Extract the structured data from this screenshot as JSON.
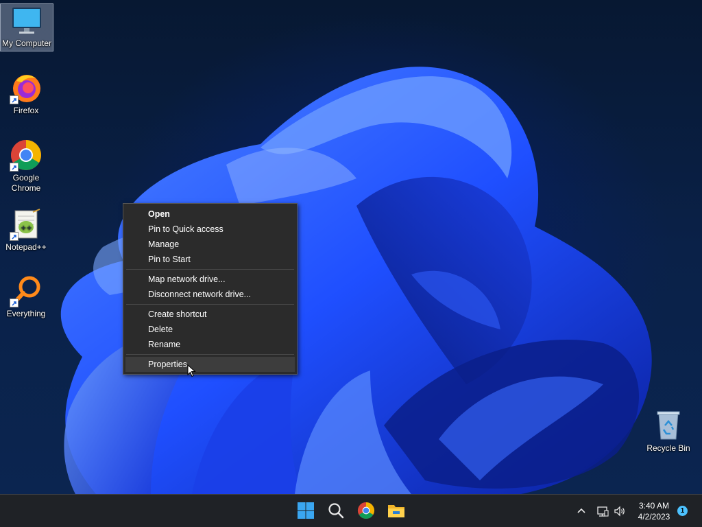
{
  "desktop": {
    "icons": [
      {
        "label": "My Computer",
        "icon": "computer-icon"
      },
      {
        "label": "Firefox",
        "icon": "firefox-icon"
      },
      {
        "label": "Google Chrome",
        "icon": "chrome-icon"
      },
      {
        "label": "Notepad++",
        "icon": "notepad-plus-plus-icon"
      },
      {
        "label": "Everything",
        "icon": "everything-search-icon"
      },
      {
        "label": "Recycle Bin",
        "icon": "recycle-bin-icon"
      }
    ]
  },
  "context_menu": {
    "items": [
      {
        "label": "Open"
      },
      {
        "label": "Pin to Quick access"
      },
      {
        "label": "Manage"
      },
      {
        "label": "Pin to Start"
      },
      {
        "label": "Map network drive..."
      },
      {
        "label": "Disconnect network drive..."
      },
      {
        "label": "Create shortcut"
      },
      {
        "label": "Delete"
      },
      {
        "label": "Rename"
      },
      {
        "label": "Properties"
      }
    ],
    "highlighted": "Properties"
  },
  "taskbar": {
    "apps": [
      {
        "icon": "start-windows-icon"
      },
      {
        "icon": "search-icon"
      },
      {
        "icon": "chrome-icon"
      },
      {
        "icon": "file-explorer-icon"
      }
    ],
    "tray": {
      "icons": [
        "chevron-up-icon",
        "network-icon",
        "volume-icon"
      ],
      "time": "3:40 AM",
      "date": "4/2/2023",
      "notification_count": "1"
    }
  },
  "colors": {
    "taskbar": "#1f2226",
    "menu_bg": "#2b2b2b",
    "menu_hover": "#3d3d3d",
    "accent": "#4cc2ff",
    "wallpaper_blue": "#1f4fff"
  }
}
